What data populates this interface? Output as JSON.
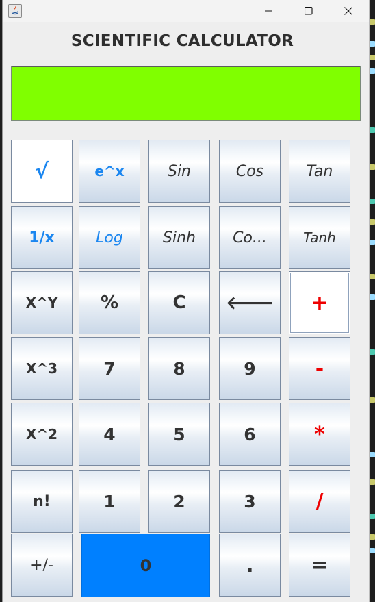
{
  "window": {
    "controls": {
      "minimize": "minimize",
      "maximize": "maximize",
      "close": "close"
    }
  },
  "title": "SCIENTIFIC CALCULATOR",
  "display": {
    "value": "",
    "bg_color": "#80ff00"
  },
  "colors": {
    "accent_blue": "#1a86f0",
    "operator_red": "#ee0000",
    "zero_key_blue": "#0080ff"
  },
  "keys": {
    "sqrt": "√",
    "exp": "e^x",
    "sin": "Sin",
    "cos": "Cos",
    "tan": "Tan",
    "reciprocal": "1/x",
    "log": "Log",
    "sinh": "Sinh",
    "cosh": "Co...",
    "tanh": "Tanh",
    "power": "X^Y",
    "percent": "%",
    "clear": "C",
    "backspace": "🡐",
    "plus": "+",
    "cube": "X^3",
    "seven": "7",
    "eight": "8",
    "nine": "9",
    "minus": "-",
    "square": "X^2",
    "four": "4",
    "five": "5",
    "six": "6",
    "multiply": "*",
    "factorial": "n!",
    "one": "1",
    "two": "2",
    "three": "3",
    "divide": "/",
    "negate": "+/-",
    "zero": "0",
    "decimal": ".",
    "equals": "="
  }
}
